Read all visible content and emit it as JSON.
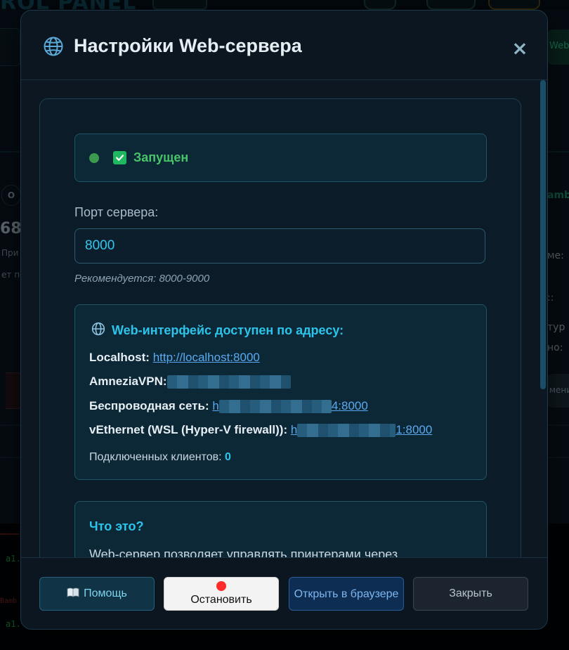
{
  "background": {
    "title": "ROL PANEL",
    "left_big": "68.",
    "left_t1": "При",
    "left_t2": "ет по",
    "right_t1": "amb",
    "right_t2": "ме:",
    "right_t3": "::",
    "right_t4": "тур",
    "right_t5": "но:",
    "right_btn": "мени",
    "right_side": "Web-",
    "left_pill": "О",
    "term_line1": "a1.",
    "term_line2": "Bamb",
    "term_line3": "a1."
  },
  "modal": {
    "title": "Настройки Web-сервера",
    "close_glyph": "×",
    "status": {
      "text": "Запущен"
    },
    "port": {
      "label": "Порт сервера:",
      "value": "8000",
      "hint": "Рекомендуется: 8000-9000"
    },
    "urls": {
      "title": "Web-интерфейс доступен по адресу:",
      "localhost_label": "Localhost:",
      "localhost_url": "http://localhost:8000",
      "amnezia_label": "AmneziaVPN:",
      "wireless_label": "Беспроводная сеть:",
      "wireless_prefix": "h",
      "wireless_suffix": "4:8000",
      "vethernet_label": "vEthernet (WSL (Hyper-V firewall)):",
      "vethernet_prefix": "h",
      "vethernet_suffix": "1:8000",
      "clients_label": "Подключенных клиентов:",
      "clients_count": "0"
    },
    "what": {
      "title": "Что это?",
      "text": "Web-сервер позволяет управлять принтерами через"
    },
    "footer": {
      "help_label": "Помощь",
      "stop_label": "Остановить",
      "open_label": "Открыть в браузере",
      "close_label": "Закрыть"
    }
  },
  "colors": {
    "accent": "#2cc4ea",
    "running": "#47c46a",
    "stop_dot": "#ff2b2b"
  }
}
